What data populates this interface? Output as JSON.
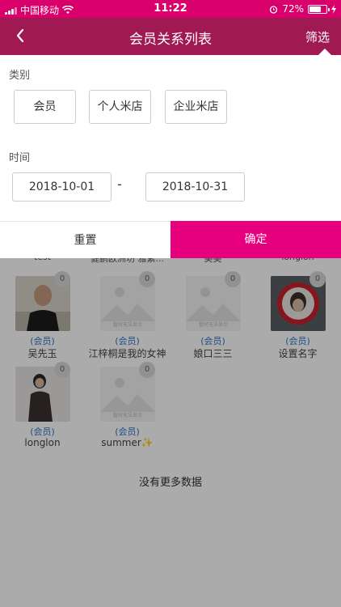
{
  "status_bar": {
    "carrier": "中国移动",
    "time": "11:22",
    "battery": "72%",
    "battery_level": 0.72
  },
  "nav": {
    "title": "会员关系列表",
    "filter_label": "筛选",
    "back_icon": "chevron-left-icon"
  },
  "filter": {
    "category_label": "类别",
    "categories": [
      "会员",
      "个人米店",
      "企业米店"
    ],
    "time_label": "时间",
    "start_date": "2018-10-01",
    "separator": "-",
    "end_date": "2018-10-31",
    "reset_label": "重置",
    "confirm_label": "确定"
  },
  "list": {
    "partial_names": [
      "test",
      "健鹏欧洲坊 雅紫...",
      "美美",
      "longlon"
    ],
    "members": [
      {
        "name": "吴先玉",
        "role": "(会员)",
        "count": "0",
        "avatar": "photo-man"
      },
      {
        "name": "江梓桐是我的女神",
        "role": "(会员)",
        "count": "0",
        "avatar": "placeholder"
      },
      {
        "name": "娘口三三",
        "role": "(会员)",
        "count": "0",
        "avatar": "placeholder"
      },
      {
        "name": "设置名字",
        "role": "(会员)",
        "count": "0",
        "avatar": "photo-mirror"
      },
      {
        "name": "longlon",
        "role": "(会员)",
        "count": "0",
        "avatar": "photo-woman"
      },
      {
        "name": "summer✨",
        "role": "(会员)",
        "count": "0",
        "avatar": "placeholder"
      }
    ],
    "placeholder_text": "暂时无法显示",
    "end_text": "没有更多数据"
  },
  "colors": {
    "status_bar": "#d9006b",
    "nav_bar": "#a01952",
    "confirm": "#e6007e",
    "role_text": "#2f74c8"
  }
}
